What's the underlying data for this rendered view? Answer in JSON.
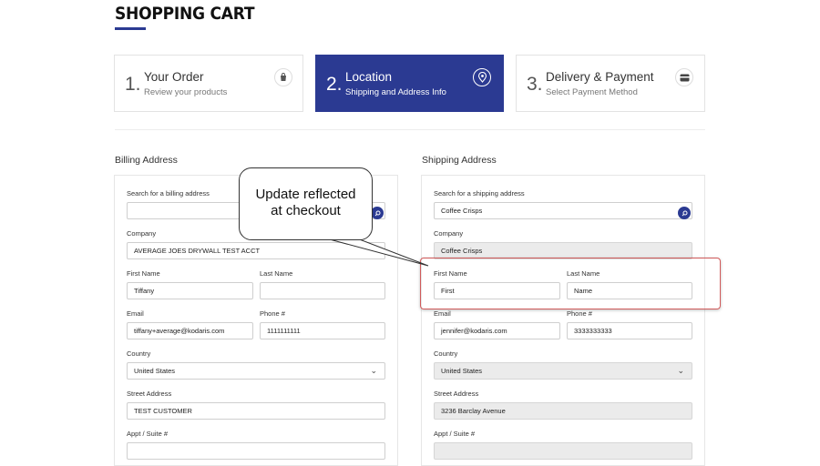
{
  "page": {
    "title": "SHOPPING CART"
  },
  "steps": [
    {
      "num": "1.",
      "title": "Your Order",
      "sub": "Review your products",
      "icon": "bag-icon"
    },
    {
      "num": "2.",
      "title": "Location",
      "sub": "Shipping and Address Info",
      "icon": "location-pin-icon"
    },
    {
      "num": "3.",
      "title": "Delivery & Payment",
      "sub": "Select Payment Method",
      "icon": "credit-card-icon"
    }
  ],
  "billing": {
    "heading": "Billing Address",
    "search_label": "Search for a billing address",
    "search_value": "",
    "company_label": "Company",
    "company_value": "AVERAGE JOES DRYWALL TEST ACCT",
    "first_name_label": "First Name",
    "first_name_value": "Tiffany",
    "last_name_label": "Last Name",
    "last_name_value": "",
    "email_label": "Email",
    "email_value": "tiffany+average@kodaris.com",
    "phone_label": "Phone #",
    "phone_value": "1111111111",
    "country_label": "Country",
    "country_value": "United States",
    "street_label": "Street Address",
    "street_value": "TEST CUSTOMER",
    "appt_label": "Appt / Suite #",
    "appt_value": ""
  },
  "shipping": {
    "heading": "Shipping Address",
    "search_label": "Search for a shipping address",
    "search_value": "Coffee Crisps",
    "company_label": "Company",
    "company_value": "Coffee Crisps",
    "first_name_label": "First Name",
    "first_name_value": "First",
    "last_name_label": "Last Name",
    "last_name_value": "Name",
    "email_label": "Email",
    "email_value": "jennifer@kodaris.com",
    "phone_label": "Phone #",
    "phone_value": "3333333333",
    "country_label": "Country",
    "country_value": "United States",
    "street_label": "Street Address",
    "street_value": "3236 Barclay Avenue",
    "appt_label": "Appt / Suite #",
    "appt_value": ""
  },
  "annotation": {
    "text_line1": "Update reflected",
    "text_line2": "at checkout"
  },
  "colors": {
    "brand": "#2b3a92",
    "highlight": "#d05a5a"
  }
}
